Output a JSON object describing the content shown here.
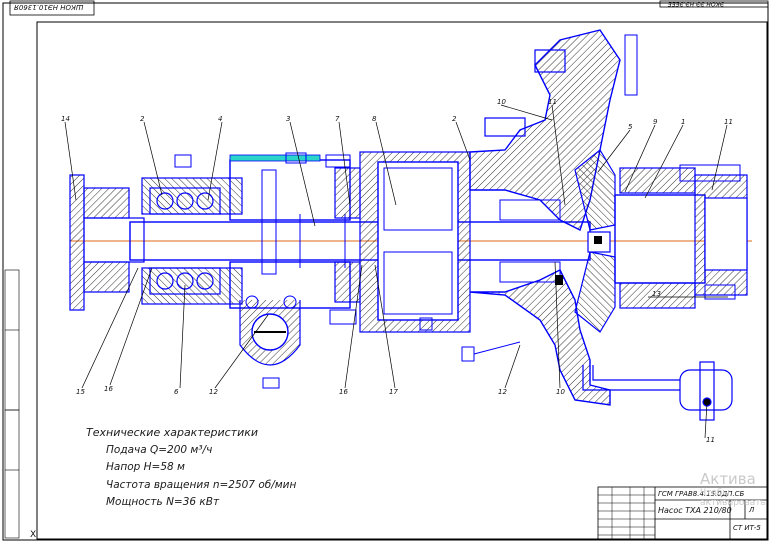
{
  "drawing": {
    "stamp_top_left": "ШКОН НЭ10.1360Я",
    "stamp_top_right": "ЭКОН ЭЭ НЭ.ЭЕЕЕ",
    "title_block": {
      "code": "ГСМ ГРАВ8.4.15.0ДП.СБ",
      "name": "Насос ТХА 210/80",
      "sheet_mark": "Л",
      "org": "СТ ИТ-5"
    },
    "corner_mark": "X",
    "callouts_top": [
      "14",
      "2",
      "4",
      "3",
      "7",
      "8",
      "2",
      "10",
      "11",
      "5",
      "9",
      "1",
      "11"
    ],
    "callouts_bottom": [
      "15",
      "16",
      "6",
      "12",
      "16",
      "17",
      "12",
      "10"
    ],
    "callout_right": "13",
    "callout_br": "11",
    "specs": {
      "heading": "Технические характеристики",
      "lines": [
        "Подача Q=200 м³/ч",
        "Напор H=58 м",
        "Частота вращения n=2507 об/мин",
        "Мощность N=36 кВт"
      ]
    },
    "watermark": "Актива",
    "watermark_sub": "Чтобы активировать"
  },
  "colors": {
    "outline": "#0000ff",
    "hatch": "#1a1a1a",
    "axis": "#e06a1a",
    "frame": "#000000"
  }
}
